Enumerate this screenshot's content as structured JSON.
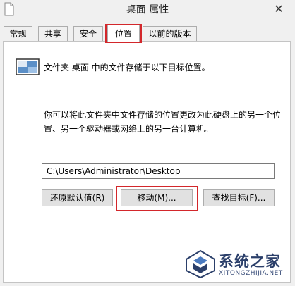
{
  "window": {
    "title": "桌面 属性",
    "close_glyph": "✕"
  },
  "tabs": [
    {
      "label": "常规",
      "active": false
    },
    {
      "label": "共享",
      "active": false
    },
    {
      "label": "安全",
      "active": false
    },
    {
      "label": "位置",
      "active": true
    },
    {
      "label": "以前的版本",
      "active": false
    }
  ],
  "location": {
    "description": "文件夹 桌面 中的文件存储于以下目标位置。",
    "explanation": "你可以将此文件夹中文件存储的位置更改为此硬盘上的另一个位置、另一个驱动器或网络上的另一台计算机。",
    "path_value": "C:\\Users\\Administrator\\Desktop"
  },
  "buttons": {
    "restore_default": "还原默认值(R)",
    "move": "移动(M)...",
    "find_target": "查找目标(F)..."
  },
  "watermark": {
    "text": "系统之家",
    "url": "XITONGZHIJIA.NET"
  },
  "colors": {
    "highlight": "#d3272b",
    "panel_bg": "#ffffff",
    "window_bg": "#f0f0f0"
  }
}
